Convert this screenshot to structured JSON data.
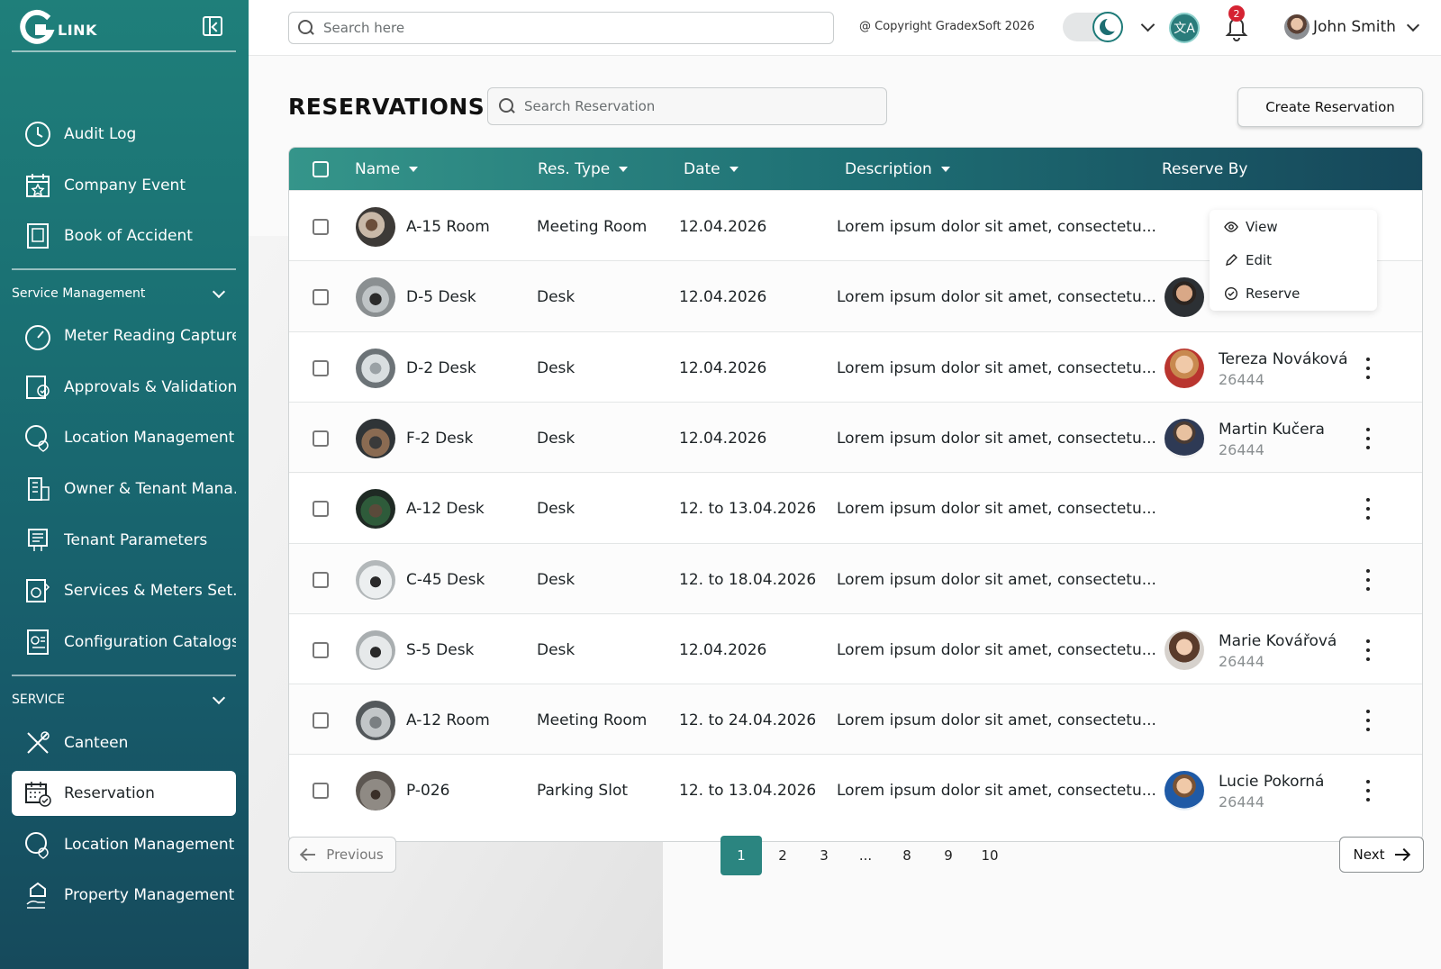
{
  "brand": {
    "name": "LINK"
  },
  "sidebar": {
    "items_top": [
      {
        "label": "Audit Log",
        "icon": "clock-icon"
      },
      {
        "label": "Company Event",
        "icon": "calendar-star-icon"
      },
      {
        "label": "Book of Accident",
        "icon": "book-icon"
      }
    ],
    "section_service_mgmt": "Service Management",
    "items_mgmt": [
      {
        "label": "Meter Reading Capture",
        "icon": "gauge-icon"
      },
      {
        "label": "Approvals & Validation",
        "icon": "approval-icon"
      },
      {
        "label": "Location Management",
        "icon": "location-pin-icon"
      },
      {
        "label": "Owner & Tenant Mana...",
        "icon": "building-icon"
      },
      {
        "label": "Tenant Parameters",
        "icon": "parameters-icon"
      },
      {
        "label": "Services & Meters Set...",
        "icon": "meter-settings-icon"
      },
      {
        "label": "Configuration Catalogs",
        "icon": "catalog-icon"
      }
    ],
    "section_service": "SERVICE",
    "items_service": [
      {
        "label": "Canteen",
        "icon": "cutlery-icon"
      },
      {
        "label": "Reservation",
        "icon": "calendar-check-icon",
        "active": true
      },
      {
        "label": "Location Management",
        "icon": "location-pin-icon"
      },
      {
        "label": "Property Management",
        "icon": "property-hand-icon"
      }
    ]
  },
  "topbar": {
    "search_placeholder": "Search here",
    "copyright": "@ Copyright GradexSoft 2026",
    "notification_count": "2",
    "user_name": "John Smith",
    "lang_icon": "translate-icon"
  },
  "page": {
    "title": "RESERVATIONS",
    "search_placeholder": "Search Reservation",
    "create_label": "Create Reservation"
  },
  "table": {
    "columns": [
      "Name",
      "Res. Type",
      "Date",
      "Description",
      "Reserve By"
    ],
    "rows": [
      {
        "name": "A-15 Room",
        "type": "Meeting Room",
        "date": "12.04.2026",
        "desc": "Lorem ipsum dolor sit amet, consectetu...",
        "person": "",
        "person_id": ""
      },
      {
        "name": "D-5 Desk",
        "type": "Desk",
        "date": "12.04.2026",
        "desc": "Lorem ipsum dolor sit amet, consectetu...",
        "person": "",
        "person_id": ""
      },
      {
        "name": "D-2 Desk",
        "type": "Desk",
        "date": "12.04.2026",
        "desc": "Lorem ipsum dolor sit amet, consectetu...",
        "person": "Tereza Nováková",
        "person_id": "26444"
      },
      {
        "name": "F-2 Desk",
        "type": "Desk",
        "date": "12.04.2026",
        "desc": "Lorem ipsum dolor sit amet, consectetu...",
        "person": "Martin Kučera",
        "person_id": "26444"
      },
      {
        "name": "A-12 Desk",
        "type": "Desk",
        "date": "12. to 13.04.2026",
        "desc": "Lorem ipsum dolor sit amet, consectetu...",
        "person": "",
        "person_id": ""
      },
      {
        "name": "C-45 Desk",
        "type": "Desk",
        "date": "12.  to 18.04.2026",
        "desc": "Lorem ipsum dolor sit amet, consectetu...",
        "person": "",
        "person_id": ""
      },
      {
        "name": "S-5 Desk",
        "type": "Desk",
        "date": "12.04.2026",
        "desc": "Lorem ipsum dolor sit amet, consectetu...",
        "person": "Marie Kovářová",
        "person_id": "26444"
      },
      {
        "name": "A-12 Room",
        "type": "Meeting Room",
        "date": "12.  to 24.04.2026",
        "desc": "Lorem ipsum dolor sit amet, consectetu...",
        "person": "",
        "person_id": ""
      },
      {
        "name": "P-026",
        "type": "Parking Slot",
        "date": "12.  to   13.04.2026",
        "desc": "Lorem ipsum dolor sit amet, consectetu...",
        "person": "Lucie Pokorná",
        "person_id": "26444"
      }
    ]
  },
  "row_menu": {
    "view": "View",
    "edit": "Edit",
    "reserve": "Reserve"
  },
  "pagination": {
    "prev": "Previous",
    "next": "Next",
    "pages": [
      "1",
      "2",
      "3",
      "...",
      "8",
      "9",
      "10"
    ],
    "current": "1"
  },
  "colors": {
    "accent": "#2b8580",
    "sidebar_top": "#1f7f7a",
    "sidebar_bottom": "#164a5c",
    "badge": "#d52332"
  }
}
